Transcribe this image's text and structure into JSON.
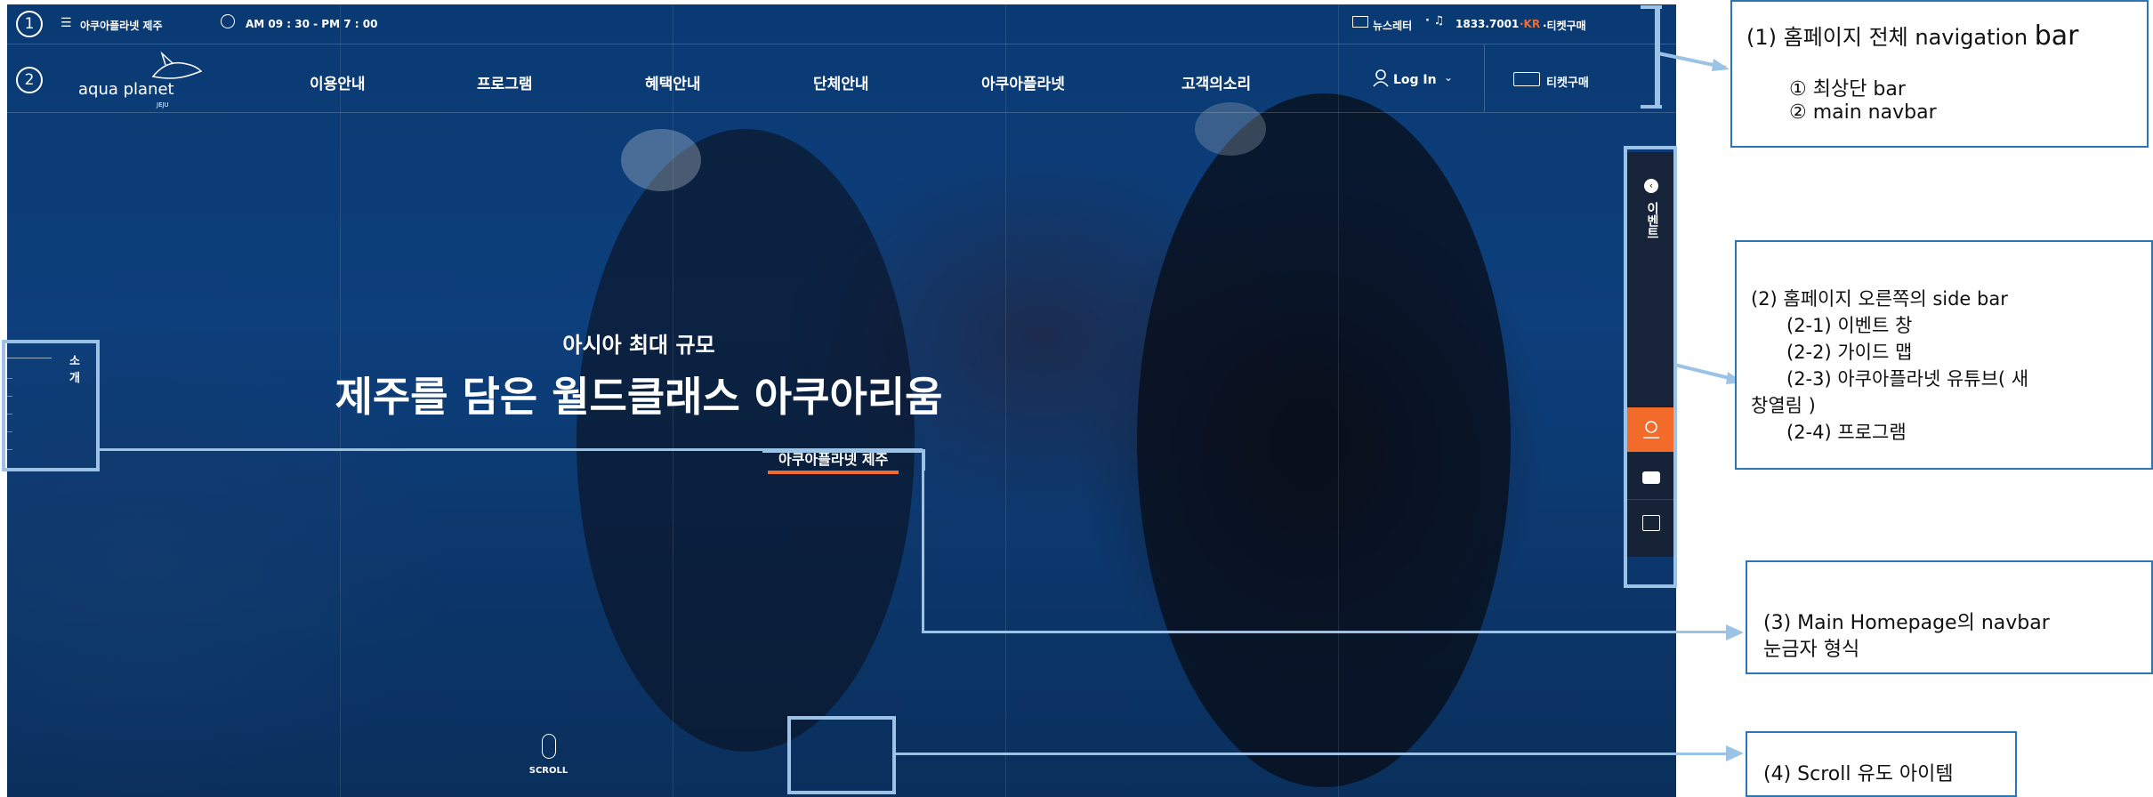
{
  "site": {
    "topbar": {
      "num": "1",
      "site_name": "아쿠아플라넷 제주",
      "hours": "AM 09 : 30 - PM 7 : 00",
      "newsletter": "뉴스레터",
      "phone": "1833.7001",
      "lang": "·KR",
      "ticket": "·티켓구매"
    },
    "nav": {
      "num": "2",
      "logo_text": "aqua planet",
      "logo_sub": "JEJU",
      "items": [
        "이용안내",
        "프로그램",
        "혜택안내",
        "단체안내",
        "아쿠아플라넷",
        "고객의소리"
      ],
      "login": "Log In",
      "ticket": "티켓구매"
    },
    "hero": {
      "subtitle": "아시아 최대 규모",
      "title": "제주를 담은 월드클래스 아쿠아리움",
      "link": "아쿠아플라넷 제주"
    },
    "ruler_label": "소개",
    "sidebar": {
      "event_label": "이벤트",
      "icons": [
        "map-pin-icon",
        "youtube-icon",
        "calendar-icon"
      ],
      "active_color": "#f26b2a"
    },
    "scroll_label": "SCROLL"
  },
  "annotations": {
    "a1": {
      "title_prefix": "(1)  홈페이지 전체 navigation ",
      "title_suffix": "bar",
      "line1": "① 최상단 bar",
      "line2": "② main navbar"
    },
    "a2": {
      "lines": [
        "(2) 홈페이지 오른쪽의 side bar",
        "(2-1) 이벤트 창",
        "(2-2) 가이드 맵",
        "(2-3) 아쿠아플라넷 유튜브( 새",
        "창열림 )",
        "(2-4) 프로그램"
      ]
    },
    "a3": {
      "line1": "(3) Main Homepage의 navbar",
      "line2": "눈금자 형식"
    },
    "a4": {
      "text": "(4) Scroll 유도 아이템"
    }
  },
  "colors": {
    "annotation_border": "#2e75b6",
    "highlight": "#9cc2e5",
    "accent": "#f26b2a"
  }
}
